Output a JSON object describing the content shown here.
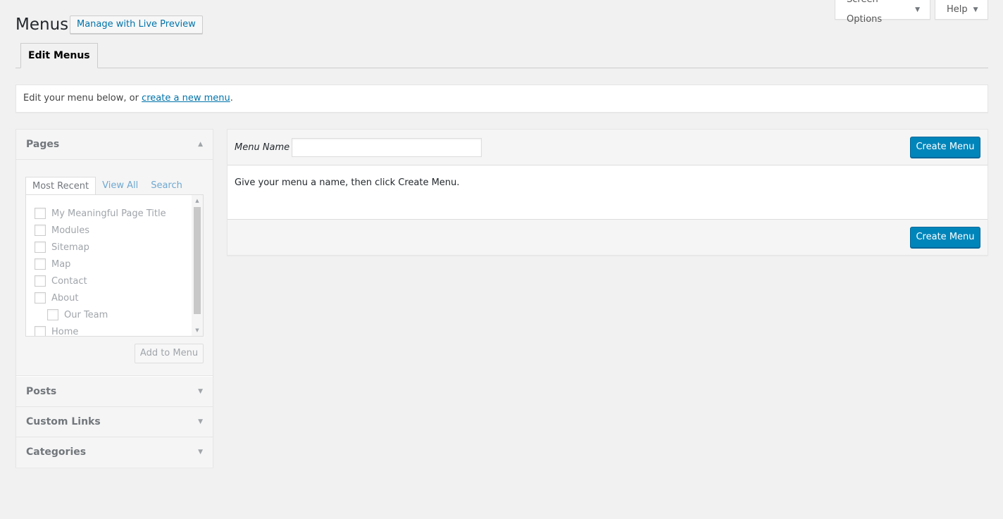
{
  "header": {
    "title": "Menus",
    "live_preview_label": "Manage with Live Preview",
    "screen_options_label": "Screen Options",
    "help_label": "Help"
  },
  "tabs": [
    {
      "label": "Edit Menus",
      "active": true
    }
  ],
  "notice": {
    "text": "Edit your menu below, or ",
    "link": "create a new menu",
    "suffix": "."
  },
  "sidebar": {
    "sections": [
      {
        "label": "Pages",
        "expanded": true
      },
      {
        "label": "Posts",
        "expanded": false
      },
      {
        "label": "Custom Links",
        "expanded": false
      },
      {
        "label": "Categories",
        "expanded": false
      }
    ],
    "pages_tabs": [
      {
        "label": "Most Recent",
        "active": true
      },
      {
        "label": "View All",
        "active": false
      },
      {
        "label": "Search",
        "active": false
      }
    ],
    "pages": [
      {
        "label": "My Meaningful Page Title",
        "indent": 0
      },
      {
        "label": "Modules",
        "indent": 0
      },
      {
        "label": "Sitemap",
        "indent": 0
      },
      {
        "label": "Map",
        "indent": 0
      },
      {
        "label": "Contact",
        "indent": 0
      },
      {
        "label": "About",
        "indent": 0
      },
      {
        "label": "Our Team",
        "indent": 1
      },
      {
        "label": "Home",
        "indent": 0
      }
    ],
    "add_to_menu_label": "Add to Menu"
  },
  "menu": {
    "name_label": "Menu Name",
    "name_value": "",
    "create_label": "Create Menu",
    "message": "Give your menu a name, then click Create Menu."
  },
  "colors": {
    "primary_button": "#0085ba",
    "link": "#0073aa",
    "background": "#f1f1f1"
  }
}
